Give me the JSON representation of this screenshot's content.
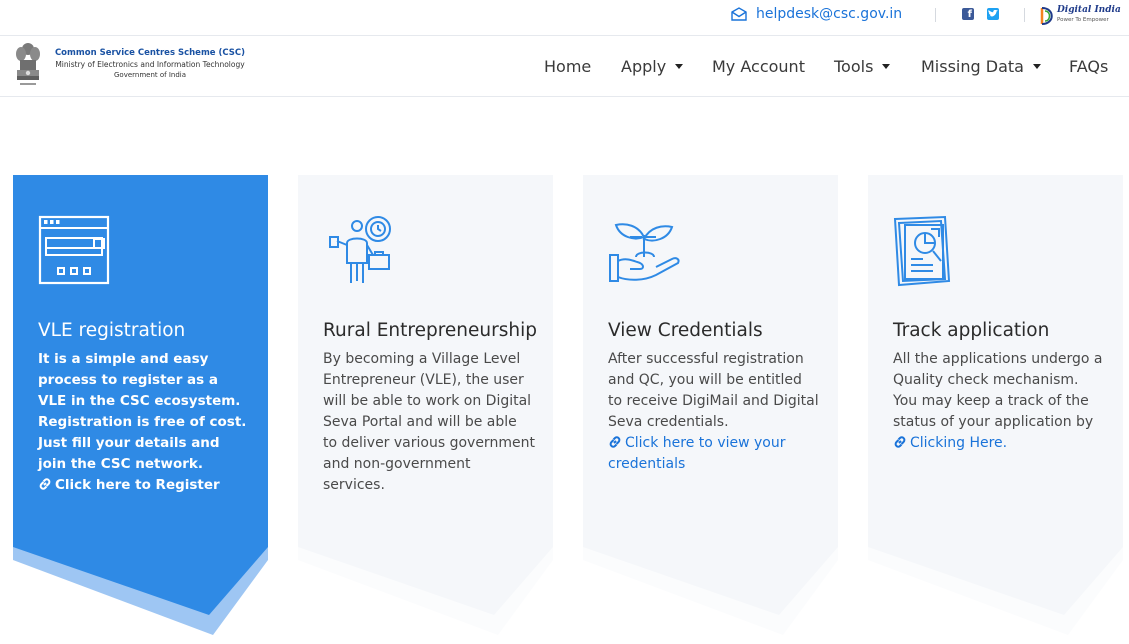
{
  "topbar": {
    "email": "helpdesk@csc.gov.in",
    "digital_india": "Digital India",
    "digital_india_tagline": "Power To Empower"
  },
  "header": {
    "brand_line1": "Common Service Centres Scheme (CSC)",
    "brand_line2": "Ministry of Electronics and Information Technology",
    "brand_line3": "Government of India"
  },
  "nav": {
    "home": "Home",
    "apply": "Apply",
    "my_account": "My Account",
    "tools": "Tools",
    "missing_data": "Missing Data",
    "faqs": "FAQs"
  },
  "cards": [
    {
      "title": "VLE registration",
      "body": "It is a simple and easy process to register as a VLE in the CSC ecosystem. Registration is free of cost. Just fill your details and join the CSC network.",
      "link": "Click here to Register"
    },
    {
      "title": "Rural Entrepreneurship",
      "body": "By becoming a Village Level Entrepreneur (VLE), the user will be able to work on Digital Seva Portal and will be able to deliver various government and non-government services.",
      "link": ""
    },
    {
      "title": "View Credentials",
      "body": "After successful registration and QC, you will be entitled to receive DigiMail and Digital Seva credentials.",
      "link": "Click here to view your credentials"
    },
    {
      "title": "Track application",
      "body": "All the applications undergo a Quality check mechanism. You may keep a track of the status of your application by",
      "link": "Clicking Here."
    }
  ],
  "colors": {
    "accent": "#2f8ae5",
    "link": "#1a73d9",
    "card_bg": "#f5f7fa"
  },
  "icons": {
    "mail": "envelope-icon",
    "facebook": "facebook-icon",
    "twitter": "twitter-icon",
    "card1": "browser-window-icon",
    "card2": "entrepreneur-icon",
    "card3": "plant-in-hand-icon",
    "card4": "report-document-icon",
    "link": "chain-link-icon"
  }
}
